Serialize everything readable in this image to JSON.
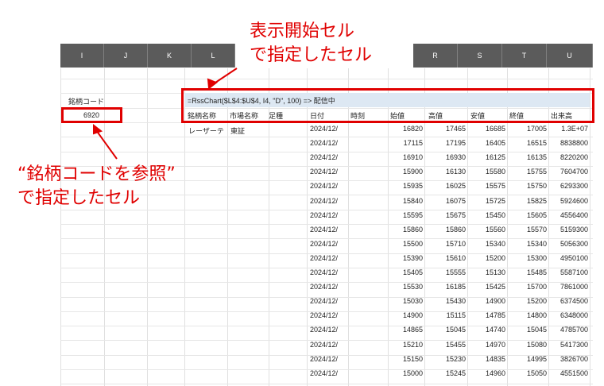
{
  "columns_left": [
    "I",
    "J",
    "K",
    "L"
  ],
  "columns_right": [
    "R",
    "S",
    "T",
    "U"
  ],
  "stock_code_label": "銘柄コード",
  "stock_code_value": "6920",
  "formula": "=RssChart($L$4:$U$4, I4, \"D\", 100) => 配信中",
  "headers": [
    "銘柄名称",
    "市場名称",
    "足種",
    "日付",
    "時刻",
    "始値",
    "高値",
    "安値",
    "終値",
    "出来高"
  ],
  "name_cell": "レーザーテ",
  "market_cell": "東証",
  "rows": [
    {
      "date": "2024/12/",
      "open": "16820",
      "high": "17465",
      "low": "16685",
      "close": "17005",
      "volume": "1.3E+07"
    },
    {
      "date": "2024/12/",
      "open": "17115",
      "high": "17195",
      "low": "16405",
      "close": "16515",
      "volume": "8838800"
    },
    {
      "date": "2024/12/",
      "open": "16910",
      "high": "16930",
      "low": "16125",
      "close": "16135",
      "volume": "8220200"
    },
    {
      "date": "2024/12/",
      "open": "15900",
      "high": "16130",
      "low": "15580",
      "close": "15755",
      "volume": "7604700"
    },
    {
      "date": "2024/12/",
      "open": "15935",
      "high": "16025",
      "low": "15575",
      "close": "15750",
      "volume": "6293300"
    },
    {
      "date": "2024/12/",
      "open": "15840",
      "high": "16075",
      "low": "15725",
      "close": "15825",
      "volume": "5924600"
    },
    {
      "date": "2024/12/",
      "open": "15595",
      "high": "15675",
      "low": "15450",
      "close": "15605",
      "volume": "4556400"
    },
    {
      "date": "2024/12/",
      "open": "15860",
      "high": "15860",
      "low": "15560",
      "close": "15570",
      "volume": "5159300"
    },
    {
      "date": "2024/12/",
      "open": "15500",
      "high": "15710",
      "low": "15340",
      "close": "15340",
      "volume": "5056300"
    },
    {
      "date": "2024/12/",
      "open": "15390",
      "high": "15610",
      "low": "15200",
      "close": "15300",
      "volume": "4950100"
    },
    {
      "date": "2024/12/",
      "open": "15405",
      "high": "15555",
      "low": "15130",
      "close": "15485",
      "volume": "5587100"
    },
    {
      "date": "2024/12/",
      "open": "15530",
      "high": "16185",
      "low": "15425",
      "close": "15700",
      "volume": "7861000"
    },
    {
      "date": "2024/12/",
      "open": "15030",
      "high": "15430",
      "low": "14900",
      "close": "15200",
      "volume": "6374500"
    },
    {
      "date": "2024/12/",
      "open": "14900",
      "high": "15115",
      "low": "14785",
      "close": "14800",
      "volume": "6348000"
    },
    {
      "date": "2024/12/",
      "open": "14865",
      "high": "15045",
      "low": "14740",
      "close": "15045",
      "volume": "4785700"
    },
    {
      "date": "2024/12/",
      "open": "15210",
      "high": "15455",
      "low": "14970",
      "close": "15080",
      "volume": "5417300"
    },
    {
      "date": "2024/12/",
      "open": "15150",
      "high": "15230",
      "low": "14835",
      "close": "14995",
      "volume": "3826700"
    },
    {
      "date": "2024/12/",
      "open": "15000",
      "high": "15245",
      "low": "14960",
      "close": "15050",
      "volume": "4551500"
    }
  ],
  "annotation_top": [
    "表示開始セル",
    "で指定したセル"
  ],
  "annotation_left": [
    "“銘柄コードを参照”",
    "で指定したセル"
  ],
  "colors": {
    "annotation": "#e00000",
    "header_bg": "#5b5b5b",
    "formula_bg": "#dde8f3"
  }
}
